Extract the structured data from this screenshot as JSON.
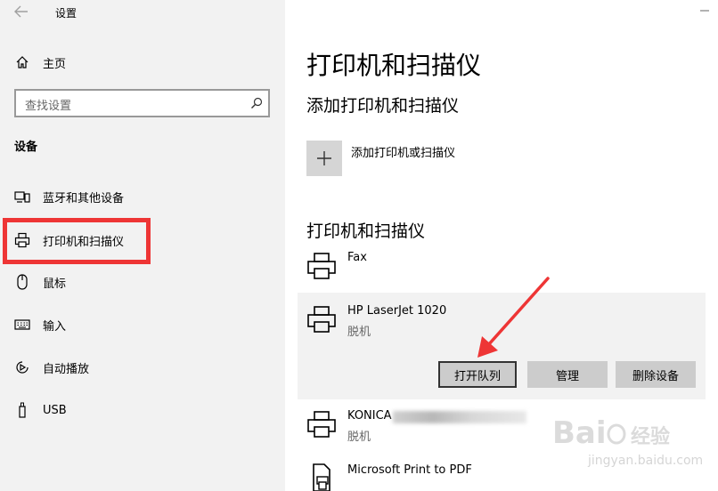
{
  "window": {
    "title": "设置"
  },
  "sidebar": {
    "home_label": "主页",
    "search_placeholder": "查找设置",
    "section_title": "设备",
    "items": [
      {
        "label": "蓝牙和其他设备",
        "icon": "devices-icon"
      },
      {
        "label": "打印机和扫描仪",
        "icon": "printer-icon",
        "selected": true
      },
      {
        "label": "鼠标",
        "icon": "mouse-icon"
      },
      {
        "label": "输入",
        "icon": "keyboard-icon"
      },
      {
        "label": "自动播放",
        "icon": "autoplay-icon"
      },
      {
        "label": "USB",
        "icon": "usb-icon"
      }
    ]
  },
  "main": {
    "page_title": "打印机和扫描仪",
    "add_section_title": "添加打印机和扫描仪",
    "add_label": "添加打印机或扫描仪",
    "list_section_title": "打印机和扫描仪",
    "devices": [
      {
        "name": "Fax",
        "status": ""
      },
      {
        "name": "HP LaserJet 1020",
        "status": "脱机",
        "selected": true
      },
      {
        "name": "KONICA",
        "status": "脱机"
      },
      {
        "name": "Microsoft Print to PDF",
        "status": ""
      }
    ],
    "actions": {
      "open_queue": "打开队列",
      "manage": "管理",
      "remove": "删除设备"
    }
  },
  "colors": {
    "highlight": "#ee3535",
    "sidebar_bg": "#f2f2f2",
    "button_bg": "#cccccc"
  },
  "watermark": {
    "site": "jingyan.baidu.com"
  }
}
